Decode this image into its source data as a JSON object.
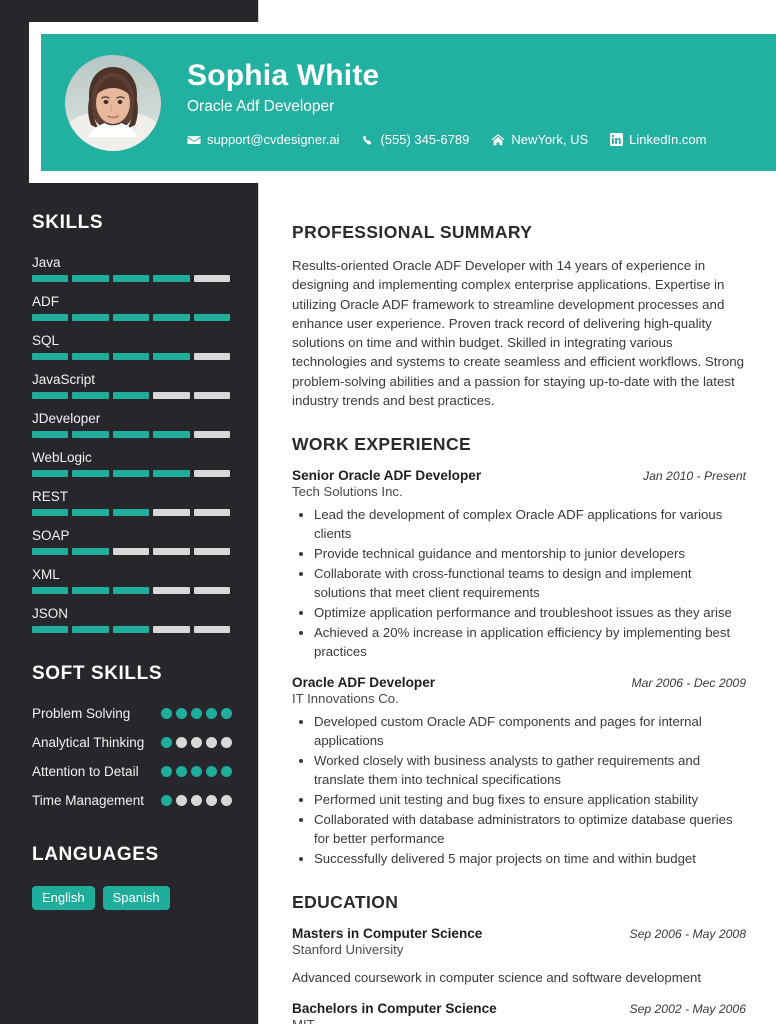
{
  "theme": {
    "accent": "#22b0a0",
    "accent_bar": "#1fae9b",
    "sidebar_bg": "#26262b",
    "empty_bar": "#d8d8d8"
  },
  "header": {
    "name": "Sophia White",
    "role": "Oracle Adf Developer",
    "contacts": [
      {
        "icon": "envelope-icon",
        "text": "support@cvdesigner.ai"
      },
      {
        "icon": "phone-icon",
        "text": "(555) 345-6789"
      },
      {
        "icon": "home-icon",
        "text": "NewYork, US"
      },
      {
        "icon": "linkedin-icon",
        "text": "LinkedIn.com"
      }
    ]
  },
  "sidebar": {
    "skills_heading": "SKILLS",
    "skills_max": 5,
    "skills": [
      {
        "label": "Java",
        "level": 4
      },
      {
        "label": "ADF",
        "level": 5
      },
      {
        "label": "SQL",
        "level": 4
      },
      {
        "label": "JavaScript",
        "level": 3
      },
      {
        "label": "JDeveloper",
        "level": 4
      },
      {
        "label": "WebLogic",
        "level": 4
      },
      {
        "label": "REST",
        "level": 3
      },
      {
        "label": "SOAP",
        "level": 2
      },
      {
        "label": "XML",
        "level": 3
      },
      {
        "label": "JSON",
        "level": 3
      }
    ],
    "soft_skills_heading": "SOFT SKILLS",
    "soft_skills_max": 5,
    "soft_skills": [
      {
        "label": "Problem Solving",
        "level": 5
      },
      {
        "label": "Analytical Thinking",
        "level": 1
      },
      {
        "label": "Attention to Detail",
        "level": 5
      },
      {
        "label": "Time Management",
        "level": 1
      }
    ],
    "languages_heading": "LANGUAGES",
    "languages": [
      "English",
      "Spanish"
    ]
  },
  "main": {
    "summary_heading": "PROFESSIONAL SUMMARY",
    "summary_text": "Results-oriented Oracle ADF Developer with 14 years of experience in designing and implementing complex enterprise applications. Expertise in utilizing Oracle ADF framework to streamline development processes and enhance user experience. Proven track record of delivering high-quality solutions on time and within budget. Skilled in integrating various technologies and systems to create seamless and efficient workflows. Strong problem-solving abilities and a passion for staying up-to-date with the latest industry trends and best practices.",
    "experience_heading": "WORK EXPERIENCE",
    "experience": [
      {
        "title": "Senior Oracle ADF Developer",
        "date": "Jan 2010 - Present",
        "company": "Tech Solutions Inc.",
        "bullets": [
          "Lead the development of complex Oracle ADF applications for various clients",
          "Provide technical guidance and mentorship to junior developers",
          "Collaborate with cross-functional teams to design and implement solutions that meet client requirements",
          "Optimize application performance and troubleshoot issues as they arise",
          "Achieved a 20% increase in application efficiency by implementing best practices"
        ]
      },
      {
        "title": "Oracle ADF Developer",
        "date": "Mar 2006 - Dec 2009",
        "company": "IT Innovations Co.",
        "bullets": [
          "Developed custom Oracle ADF components and pages for internal applications",
          "Worked closely with business analysts to gather requirements and translate them into technical specifications",
          "Performed unit testing and bug fixes to ensure application stability",
          "Collaborated with database administrators to optimize database queries for better performance",
          "Successfully delivered 5 major projects on time and within budget"
        ]
      }
    ],
    "education_heading": "EDUCATION",
    "education": [
      {
        "degree": "Masters in Computer Science",
        "date": "Sep 2006 - May 2008",
        "school": "Stanford University",
        "note": "Advanced coursework in computer science and software development"
      },
      {
        "degree": "Bachelors in Computer Science",
        "date": "Sep 2002 - May 2006",
        "school": "MIT",
        "note": ""
      }
    ]
  }
}
